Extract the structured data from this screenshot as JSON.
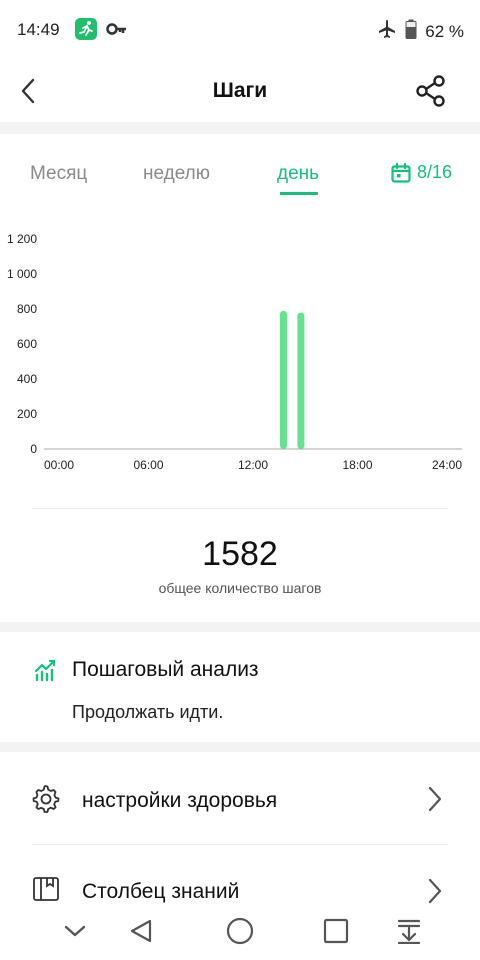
{
  "status_bar": {
    "time": "14:49",
    "battery": "62 %"
  },
  "header": {
    "title": "Шаги"
  },
  "tabs": [
    {
      "label": "Месяц",
      "active": false
    },
    {
      "label": "неделю",
      "active": false
    },
    {
      "label": "день",
      "active": true
    }
  ],
  "date_picker": {
    "label": "8/16"
  },
  "chart_data": {
    "type": "bar",
    "x": [
      "00:00",
      "06:00",
      "12:00",
      "18:00",
      "24:00"
    ],
    "y_ticks": [
      "0",
      "200",
      "400",
      "600",
      "800",
      "1 000",
      "1 200"
    ],
    "ylim": [
      0,
      1200
    ],
    "xlim_hours": [
      0,
      24
    ],
    "series": [
      {
        "values": [
          {
            "hour": 13.75,
            "value": 790
          },
          {
            "hour": 14.75,
            "value": 780
          }
        ]
      }
    ],
    "color": "#63e38d"
  },
  "summary": {
    "total_steps": "1582",
    "total_label": "общее количество шагов"
  },
  "analysis": {
    "title": "Пошаговый анализ",
    "text": "Продолжать идти."
  },
  "settings": [
    {
      "label": "настройки здоровья",
      "icon": "gear-icon"
    },
    {
      "label": "Столбец знаний",
      "icon": "book-icon"
    }
  ],
  "colors": {
    "accent": "#16c07a",
    "bar": "#63e38d",
    "separator": "#f3f3f3"
  }
}
